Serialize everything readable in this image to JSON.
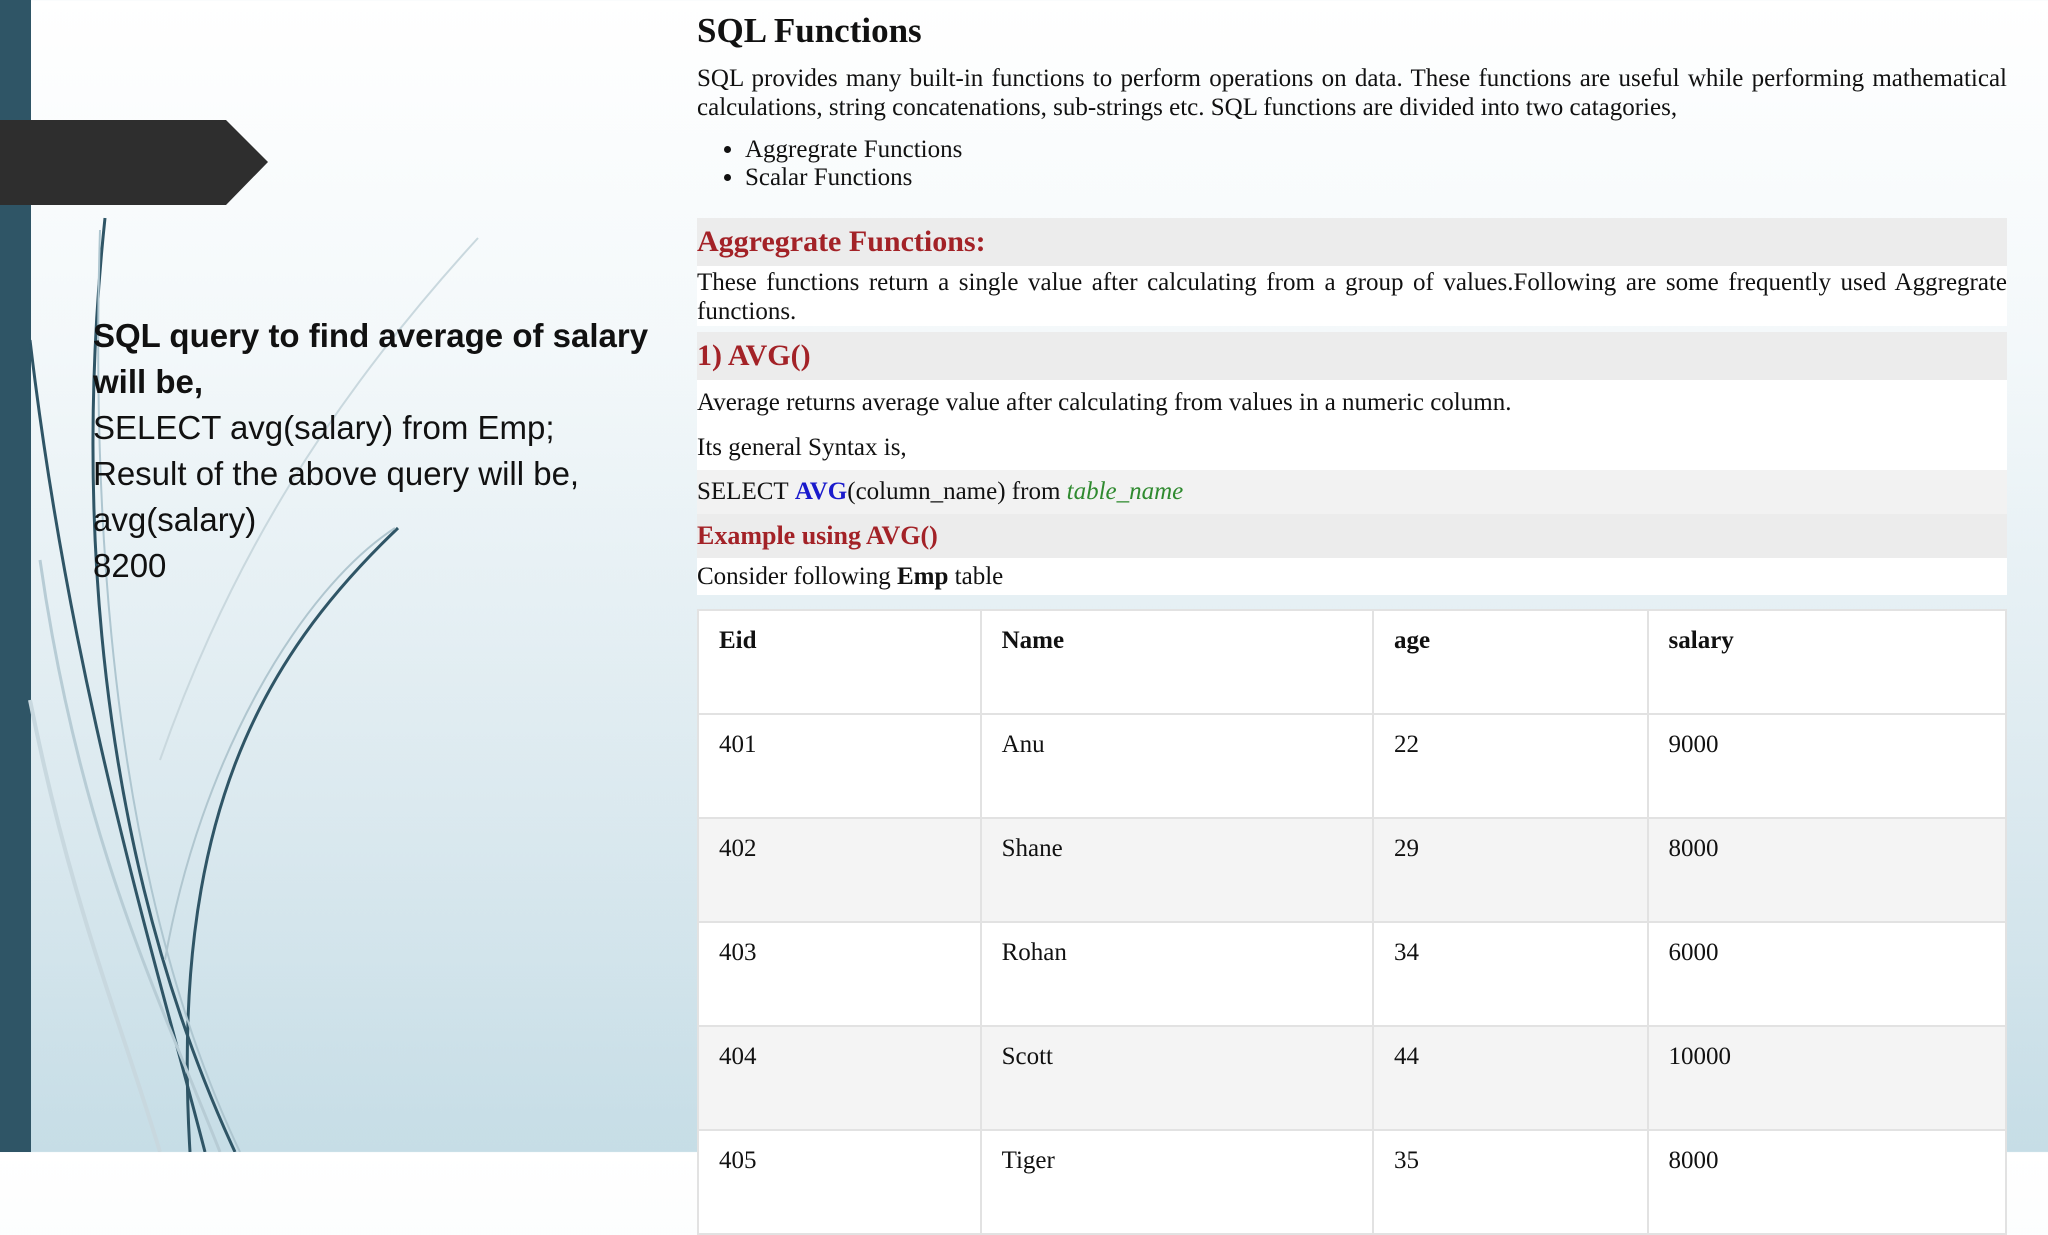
{
  "left_panel": {
    "heading": "SQL query to find average of salary will be,",
    "query": "SELECT avg(salary) from Emp;",
    "result_caption": "Result of the above query will be,",
    "column_name": "avg(salary)",
    "result_value": "8200"
  },
  "document": {
    "title": "SQL Functions",
    "intro": "SQL provides many built-in functions to perform operations on data. These functions are useful while performing mathematical calculations, string concatenations, sub-strings etc. SQL functions are divided into two catagories,",
    "categories": [
      "Aggregrate Functions",
      "Scalar Functions"
    ],
    "aggregate_heading": "Aggregrate Functions:",
    "aggregate_desc": "These functions return a single value after calculating from a group of values.Following are some frequently used Aggregrate functions.",
    "avg_heading": "1) AVG()",
    "avg_desc": "Average returns average value after calculating from values in a numeric column.",
    "syntax_label": "Its general Syntax is,",
    "syntax": {
      "select": "SELECT",
      "func": "AVG",
      "args": "(column_name) from",
      "table": "table_name"
    },
    "example_heading": "Example using AVG()",
    "consider": {
      "before": "Consider following",
      "table_name": "Emp",
      "after": "table"
    }
  },
  "table": {
    "headers": [
      "Eid",
      "Name",
      "age",
      "salary"
    ],
    "rows": [
      [
        "401",
        "Anu",
        "22",
        "9000"
      ],
      [
        "402",
        "Shane",
        "29",
        "8000"
      ],
      [
        "403",
        "Rohan",
        "34",
        "6000"
      ],
      [
        "404",
        "Scott",
        "44",
        "10000"
      ],
      [
        "405",
        "Tiger",
        "35",
        "8000"
      ]
    ]
  },
  "colors": {
    "sidebar": "#2f5566",
    "banner": "#2e2e2e",
    "heading_red": "#a32227",
    "keyword_blue": "#1a1acc",
    "table_green": "#2f8a2f"
  }
}
